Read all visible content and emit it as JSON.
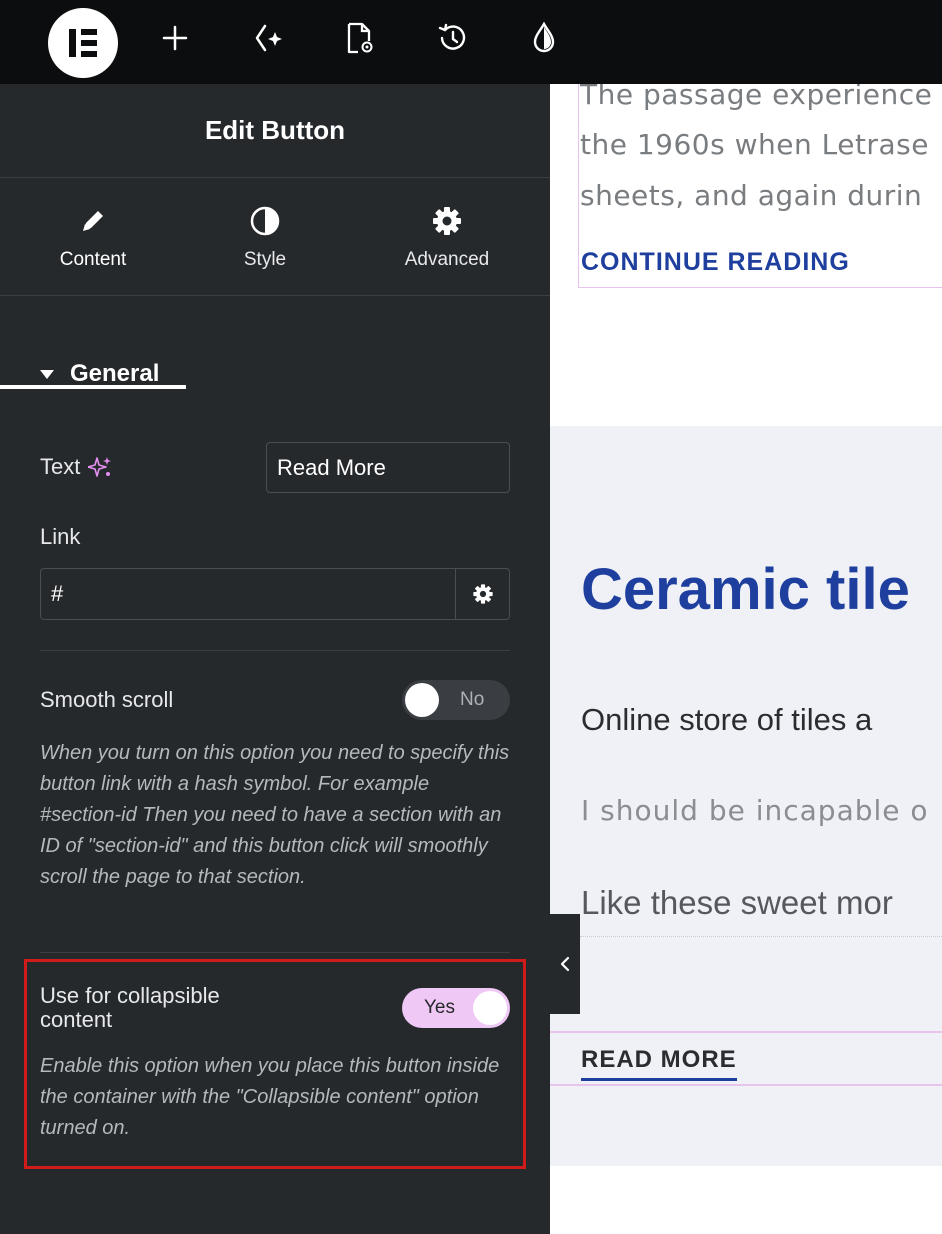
{
  "toolbar": {
    "icons": [
      "elementor-logo-icon",
      "plus-icon",
      "ai-sparkle-icon",
      "page-settings-icon",
      "history-icon",
      "theme-style-icon"
    ]
  },
  "panel": {
    "title": "Edit Button",
    "tabs": [
      {
        "label": "Content",
        "icon": "pencil-icon",
        "active": true
      },
      {
        "label": "Style",
        "icon": "contrast-icon",
        "active": false
      },
      {
        "label": "Advanced",
        "icon": "gear-icon",
        "active": false
      }
    ],
    "section": "General",
    "text_label": "Text",
    "text_value": "Read More",
    "link_label": "Link",
    "link_value": "#",
    "smooth_scroll": {
      "label": "Smooth scroll",
      "toggle_label": "No",
      "enabled": false,
      "help": "When you turn on this option you need to specify this button link with a hash symbol. For example #section-id Then you need to have a section with an ID of \"section-id\" and this button click will smoothly scroll the page to that section."
    },
    "collapsible": {
      "label_line1": "Use for collapsible",
      "label_line2": "content",
      "toggle_label": "Yes",
      "enabled": true,
      "help": "Enable this option when you place this button inside the container with the \"Collapsible content\" option turned on."
    },
    "colors": {
      "panel_bg": "#26292c",
      "toggle_on": "#f0c8f5",
      "highlight": "#d11a1a"
    }
  },
  "preview": {
    "post_lines": [
      "The passage experience",
      "the 1960s when Letrase",
      "sheets, and again durin"
    ],
    "continue_reading": "CONTINUE READING",
    "heading": "Ceramic tile",
    "subheading": "Online store of tiles a",
    "paragraph": "I should be incapable o",
    "sweet": "Like these sweet mor",
    "read_more": "READ MORE",
    "colors": {
      "accent": "#1e3f9e",
      "section_bg": "#eff1f6"
    }
  }
}
